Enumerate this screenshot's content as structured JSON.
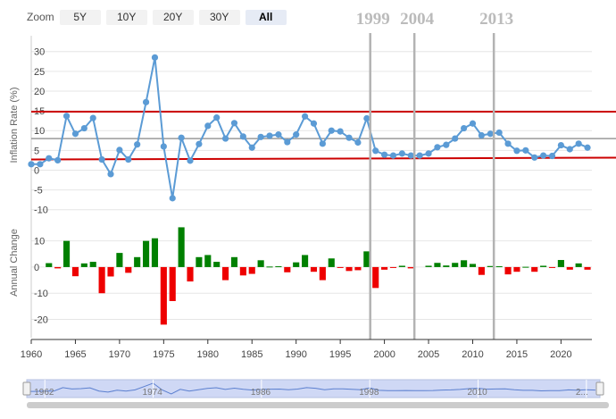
{
  "zoom": {
    "label": "Zoom",
    "buttons": [
      "5Y",
      "10Y",
      "20Y",
      "30Y",
      "All"
    ],
    "active": "All"
  },
  "colors": {
    "line": "#5b9bd5",
    "threshold": "#cc0000",
    "positive": "#008000",
    "negative": "#ee0000",
    "marker_line": "#b3b3b3",
    "mean_line": "#999999"
  },
  "chart_data": {
    "type": "line+bar",
    "x_ticks": [
      1960,
      1965,
      1970,
      1975,
      1980,
      1985,
      1990,
      1995,
      2000,
      2005,
      2010,
      2015,
      2020
    ],
    "years": [
      1960,
      1961,
      1962,
      1963,
      1964,
      1965,
      1966,
      1967,
      1968,
      1969,
      1970,
      1971,
      1972,
      1973,
      1974,
      1975,
      1976,
      1977,
      1978,
      1979,
      1980,
      1981,
      1982,
      1983,
      1984,
      1985,
      1986,
      1987,
      1988,
      1989,
      1990,
      1991,
      1992,
      1993,
      1994,
      1995,
      1996,
      1997,
      1998,
      1999,
      2000,
      2001,
      2002,
      2003,
      2004,
      2005,
      2006,
      2007,
      2008,
      2009,
      2010,
      2011,
      2012,
      2013,
      2014,
      2015,
      2016,
      2017,
      2018,
      2019,
      2020,
      2021,
      2022,
      2023
    ],
    "inflation": {
      "ylabel": "Inflation Rate (%)",
      "yticks": [
        -10,
        -5,
        0,
        5,
        10,
        15,
        20,
        25,
        30
      ],
      "ylim": [
        -13,
        34
      ],
      "values": [
        1.5,
        1.5,
        3.0,
        2.5,
        13.7,
        9.2,
        10.6,
        13.2,
        2.7,
        -1.0,
        5.1,
        2.7,
        6.5,
        17.2,
        28.5,
        6.0,
        -7.1,
        8.2,
        2.4,
        6.6,
        11.2,
        13.3,
        8.0,
        11.9,
        8.5,
        5.7,
        8.4,
        8.7,
        9.0,
        7.1,
        9.0,
        13.6,
        11.8,
        6.7,
        10.0,
        9.8,
        8.2,
        7.0,
        13.1,
        4.9,
        3.9,
        3.7,
        4.2,
        3.7,
        3.7,
        4.2,
        5.8,
        6.4,
        8.0,
        10.6,
        11.8,
        8.8,
        9.2,
        9.5,
        6.7,
        4.9,
        5.0,
        3.2,
        3.7,
        3.6,
        6.3,
        5.3,
        6.7,
        5.7
      ],
      "upper_threshold": 14.8,
      "lower_threshold": 2.7,
      "mean_line": 8.0
    },
    "annual_change": {
      "ylabel": "Annual Change",
      "yticks": [
        -20,
        -10,
        0,
        10
      ],
      "ylim": [
        -27,
        15
      ],
      "values": [
        0,
        0,
        1.5,
        -0.5,
        10.0,
        -3.5,
        1.4,
        2.0,
        -10.0,
        -3.6,
        5.4,
        -2.2,
        3.8,
        10.0,
        11.0,
        -22.0,
        -13.0,
        15.2,
        -5.5,
        3.8,
        4.6,
        2.0,
        -5.0,
        3.8,
        -3.2,
        -2.6,
        2.6,
        0.2,
        0.3,
        -2.0,
        1.8,
        4.6,
        -1.8,
        -5.0,
        3.3,
        -0.2,
        -1.5,
        -1.2,
        6.0,
        -8.0,
        -1.0,
        -0.2,
        0.5,
        -0.5,
        0,
        0.5,
        1.6,
        0.6,
        1.6,
        2.6,
        1.2,
        -3.0,
        0.4,
        0.3,
        -2.8,
        -1.8,
        0.1,
        -1.8,
        0.5,
        -0.1,
        2.7,
        -1.0,
        1.4,
        -1.0
      ]
    },
    "event_markers": [
      {
        "year": 1999,
        "label": "1999"
      },
      {
        "year": 2004,
        "label": "2004"
      },
      {
        "year": 2013,
        "label": "2013"
      }
    ],
    "navigator": {
      "labels": [
        "1962",
        "1974",
        "1986",
        "1998",
        "2010",
        "2..."
      ]
    }
  }
}
